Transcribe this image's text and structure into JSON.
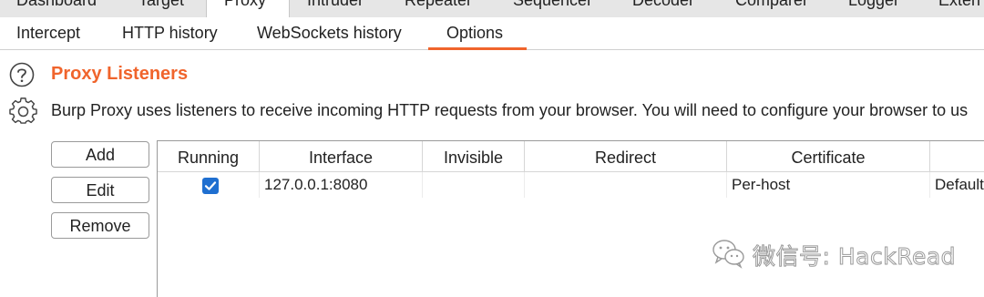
{
  "main_tabs": [
    {
      "label": "Dashboard"
    },
    {
      "label": "Target"
    },
    {
      "label": "Proxy"
    },
    {
      "label": "Intruder"
    },
    {
      "label": "Repeater"
    },
    {
      "label": "Sequencer"
    },
    {
      "label": "Decoder"
    },
    {
      "label": "Comparer"
    },
    {
      "label": "Logger"
    },
    {
      "label": "Exten"
    }
  ],
  "sub_tabs": [
    {
      "label": "Intercept"
    },
    {
      "label": "HTTP history"
    },
    {
      "label": "WebSockets history"
    },
    {
      "label": "Options"
    }
  ],
  "active_main_tab": "Proxy",
  "active_sub_tab": "Options",
  "section": {
    "title": "Proxy Listeners",
    "description": "Burp Proxy uses listeners to receive incoming HTTP requests from your browser. You will need to configure your browser to us"
  },
  "buttons": {
    "add": "Add",
    "edit": "Edit",
    "remove": "Remove"
  },
  "table": {
    "columns": [
      "Running",
      "Interface",
      "Invisible",
      "Redirect",
      "Certificate",
      ""
    ],
    "rows": [
      {
        "running": true,
        "interface": "127.0.0.1:8080",
        "invisible": "",
        "redirect": "",
        "certificate": "Per-host",
        "extra": "Default"
      }
    ]
  },
  "watermark": {
    "text": "微信号: HackRead",
    "icon": "wechat-icon"
  },
  "colors": {
    "accent": "#f0642c",
    "checkbox": "#1f6fd0",
    "tab_bar_bg": "#e6e6e6"
  },
  "icons": {
    "help": "help-circle-icon",
    "settings": "gear-icon",
    "check": "check-icon"
  }
}
